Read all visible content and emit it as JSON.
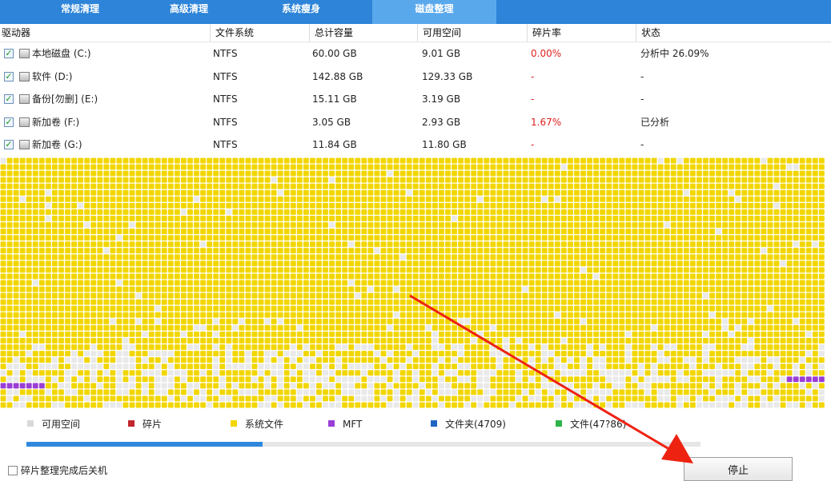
{
  "tabs": [
    {
      "label": "常规清理",
      "active": false
    },
    {
      "label": "高级清理",
      "active": false
    },
    {
      "label": "系统瘦身",
      "active": false
    },
    {
      "label": "磁盘整理",
      "active": true
    }
  ],
  "table": {
    "columns": [
      "驱动器",
      "文件系统",
      "总计容量",
      "可用空间",
      "碎片率",
      "状态"
    ],
    "rows": [
      {
        "checked": true,
        "drive": "本地磁盘 (C:)",
        "fs": "NTFS",
        "total": "60.00 GB",
        "free": "9.01 GB",
        "frag": "0.00%",
        "status": "分析中 26.09%"
      },
      {
        "checked": true,
        "drive": "软件 (D:)",
        "fs": "NTFS",
        "total": "142.88 GB",
        "free": "129.33 GB",
        "frag": "-",
        "status": "-"
      },
      {
        "checked": true,
        "drive": "备份[勿删] (E:)",
        "fs": "NTFS",
        "total": "15.11 GB",
        "free": "3.19 GB",
        "frag": "-",
        "status": "-"
      },
      {
        "checked": true,
        "drive": "新加卷 (F:)",
        "fs": "NTFS",
        "total": "3.05 GB",
        "free": "2.93 GB",
        "frag": "1.67%",
        "status": "已分析"
      },
      {
        "checked": true,
        "drive": "新加卷 (G:)",
        "fs": "NTFS",
        "total": "11.84 GB",
        "free": "11.80 GB",
        "frag": "-",
        "status": "-"
      }
    ]
  },
  "legend": [
    {
      "label": "可用空间",
      "color": "#d9d9d9"
    },
    {
      "label": "碎片",
      "color": "#c1272d"
    },
    {
      "label": "系统文件",
      "color": "#f2d600"
    },
    {
      "label": "MFT",
      "color": "#9a3ed6"
    },
    {
      "label": "文件夹(4709)",
      "color": "#1f66c4"
    },
    {
      "label": "文件(47?86)",
      "color": "#2fb34a"
    }
  ],
  "progress": 0.35,
  "shutdown_option": {
    "label": "碎片整理完成后关机",
    "checked": false
  },
  "stop_label": "停止",
  "colors": {
    "tabbar": "#2d84d8",
    "tab_active": "#5aa8ec",
    "system_file": "#f2d600",
    "free_space": "#e9e9e9",
    "mft": "#9a3ed6",
    "fragment_text": "#e02020",
    "annotation_arrow": "#ee2211"
  }
}
